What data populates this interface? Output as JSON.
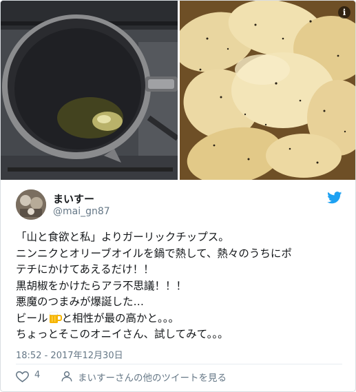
{
  "user": {
    "display_name": "まいすー",
    "handle": "@mai_gn87"
  },
  "tweet": {
    "lines": [
      "「山と食欲と私」よりガーリックチップス。",
      "ニンニクとオリーブオイルを鍋で熱して、熱々のうちにポ",
      "テチにかけてあえるだけ！！",
      "黒胡椒をかけたらアラ不思議！！！",
      "悪魔のつまみが爆誕した…"
    ],
    "beer_line_before": "ビール",
    "beer_line_after": "と相性が最の高かと。。。",
    "last_line": "ちょっとそこのオニイさん、試してみて。。。"
  },
  "timestamp": "18:52 - 2017年12月30日",
  "actions": {
    "like_count": "4",
    "more_tweets_label": "まいすーさんの他のツイートを見る"
  },
  "icons": {
    "info": "info-icon",
    "bird": "twitter-bird-icon",
    "like": "heart-icon",
    "more": "person-icon",
    "beer": "beer-mug-icon"
  },
  "colors": {
    "twitter_blue": "#1da1f2",
    "secondary_text": "#657786",
    "primary_text": "#14171a"
  }
}
